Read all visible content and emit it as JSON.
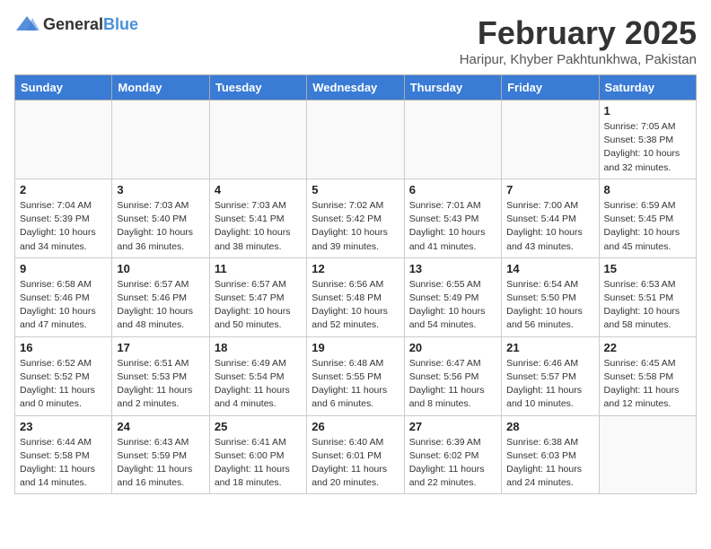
{
  "header": {
    "logo_general": "General",
    "logo_blue": "Blue",
    "month_title": "February 2025",
    "location": "Haripur, Khyber Pakhtunkhwa, Pakistan"
  },
  "weekdays": [
    "Sunday",
    "Monday",
    "Tuesday",
    "Wednesday",
    "Thursday",
    "Friday",
    "Saturday"
  ],
  "weeks": [
    [
      {
        "day": "",
        "info": ""
      },
      {
        "day": "",
        "info": ""
      },
      {
        "day": "",
        "info": ""
      },
      {
        "day": "",
        "info": ""
      },
      {
        "day": "",
        "info": ""
      },
      {
        "day": "",
        "info": ""
      },
      {
        "day": "1",
        "info": "Sunrise: 7:05 AM\nSunset: 5:38 PM\nDaylight: 10 hours\nand 32 minutes."
      }
    ],
    [
      {
        "day": "2",
        "info": "Sunrise: 7:04 AM\nSunset: 5:39 PM\nDaylight: 10 hours\nand 34 minutes."
      },
      {
        "day": "3",
        "info": "Sunrise: 7:03 AM\nSunset: 5:40 PM\nDaylight: 10 hours\nand 36 minutes."
      },
      {
        "day": "4",
        "info": "Sunrise: 7:03 AM\nSunset: 5:41 PM\nDaylight: 10 hours\nand 38 minutes."
      },
      {
        "day": "5",
        "info": "Sunrise: 7:02 AM\nSunset: 5:42 PM\nDaylight: 10 hours\nand 39 minutes."
      },
      {
        "day": "6",
        "info": "Sunrise: 7:01 AM\nSunset: 5:43 PM\nDaylight: 10 hours\nand 41 minutes."
      },
      {
        "day": "7",
        "info": "Sunrise: 7:00 AM\nSunset: 5:44 PM\nDaylight: 10 hours\nand 43 minutes."
      },
      {
        "day": "8",
        "info": "Sunrise: 6:59 AM\nSunset: 5:45 PM\nDaylight: 10 hours\nand 45 minutes."
      }
    ],
    [
      {
        "day": "9",
        "info": "Sunrise: 6:58 AM\nSunset: 5:46 PM\nDaylight: 10 hours\nand 47 minutes."
      },
      {
        "day": "10",
        "info": "Sunrise: 6:57 AM\nSunset: 5:46 PM\nDaylight: 10 hours\nand 48 minutes."
      },
      {
        "day": "11",
        "info": "Sunrise: 6:57 AM\nSunset: 5:47 PM\nDaylight: 10 hours\nand 50 minutes."
      },
      {
        "day": "12",
        "info": "Sunrise: 6:56 AM\nSunset: 5:48 PM\nDaylight: 10 hours\nand 52 minutes."
      },
      {
        "day": "13",
        "info": "Sunrise: 6:55 AM\nSunset: 5:49 PM\nDaylight: 10 hours\nand 54 minutes."
      },
      {
        "day": "14",
        "info": "Sunrise: 6:54 AM\nSunset: 5:50 PM\nDaylight: 10 hours\nand 56 minutes."
      },
      {
        "day": "15",
        "info": "Sunrise: 6:53 AM\nSunset: 5:51 PM\nDaylight: 10 hours\nand 58 minutes."
      }
    ],
    [
      {
        "day": "16",
        "info": "Sunrise: 6:52 AM\nSunset: 5:52 PM\nDaylight: 11 hours\nand 0 minutes."
      },
      {
        "day": "17",
        "info": "Sunrise: 6:51 AM\nSunset: 5:53 PM\nDaylight: 11 hours\nand 2 minutes."
      },
      {
        "day": "18",
        "info": "Sunrise: 6:49 AM\nSunset: 5:54 PM\nDaylight: 11 hours\nand 4 minutes."
      },
      {
        "day": "19",
        "info": "Sunrise: 6:48 AM\nSunset: 5:55 PM\nDaylight: 11 hours\nand 6 minutes."
      },
      {
        "day": "20",
        "info": "Sunrise: 6:47 AM\nSunset: 5:56 PM\nDaylight: 11 hours\nand 8 minutes."
      },
      {
        "day": "21",
        "info": "Sunrise: 6:46 AM\nSunset: 5:57 PM\nDaylight: 11 hours\nand 10 minutes."
      },
      {
        "day": "22",
        "info": "Sunrise: 6:45 AM\nSunset: 5:58 PM\nDaylight: 11 hours\nand 12 minutes."
      }
    ],
    [
      {
        "day": "23",
        "info": "Sunrise: 6:44 AM\nSunset: 5:58 PM\nDaylight: 11 hours\nand 14 minutes."
      },
      {
        "day": "24",
        "info": "Sunrise: 6:43 AM\nSunset: 5:59 PM\nDaylight: 11 hours\nand 16 minutes."
      },
      {
        "day": "25",
        "info": "Sunrise: 6:41 AM\nSunset: 6:00 PM\nDaylight: 11 hours\nand 18 minutes."
      },
      {
        "day": "26",
        "info": "Sunrise: 6:40 AM\nSunset: 6:01 PM\nDaylight: 11 hours\nand 20 minutes."
      },
      {
        "day": "27",
        "info": "Sunrise: 6:39 AM\nSunset: 6:02 PM\nDaylight: 11 hours\nand 22 minutes."
      },
      {
        "day": "28",
        "info": "Sunrise: 6:38 AM\nSunset: 6:03 PM\nDaylight: 11 hours\nand 24 minutes."
      },
      {
        "day": "",
        "info": ""
      }
    ]
  ]
}
